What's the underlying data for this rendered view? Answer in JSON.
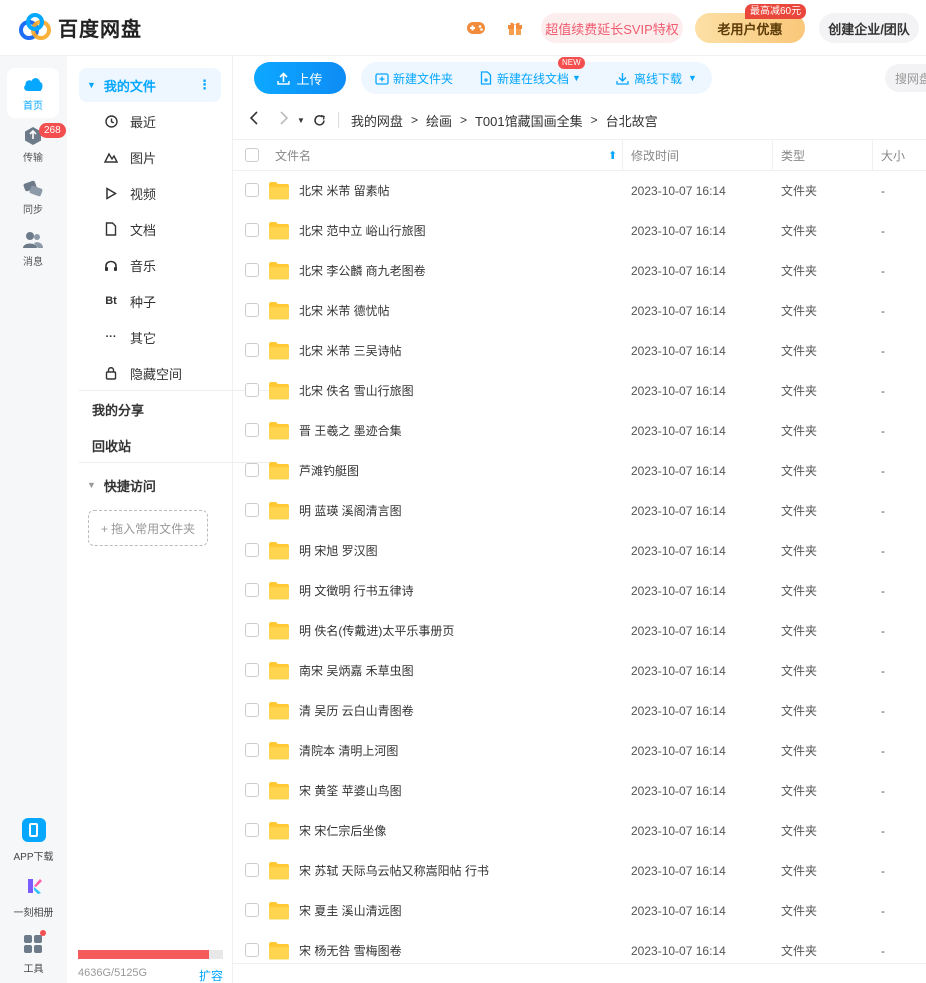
{
  "header": {
    "logo_text": "百度网盘",
    "svip_promo": "超值续费延长SVIP特权",
    "old_user_offer": "老用户优惠",
    "old_user_tag": "最高减60元",
    "enterprise": "创建企业/团队"
  },
  "rail": {
    "home": "首页",
    "transfer": "传输",
    "transfer_badge": "268",
    "sync": "同步",
    "messages": "消息",
    "app_download": "APP下载",
    "album": "一刻相册",
    "tools": "工具"
  },
  "sidebar": {
    "my_files": "我的文件",
    "more": "⋮",
    "items": [
      {
        "label": "最近",
        "icon": "clock-icon"
      },
      {
        "label": "图片",
        "icon": "image-icon"
      },
      {
        "label": "视频",
        "icon": "play-icon"
      },
      {
        "label": "文档",
        "icon": "document-icon"
      },
      {
        "label": "音乐",
        "icon": "headphones-icon"
      },
      {
        "label": "种子",
        "icon": "bt-icon",
        "glyph": "Bt"
      },
      {
        "label": "其它",
        "icon": "ellipsis-icon",
        "glyph": "···"
      },
      {
        "label": "隐藏空间",
        "icon": "lock-icon"
      }
    ],
    "my_share": "我的分享",
    "recycle": "回收站",
    "quick_access": "快捷访问",
    "drop_hint": "+ 拖入常用文件夹",
    "storage_text": "4636G/5125G",
    "storage_used_fraction": 0.905,
    "expand": "扩容"
  },
  "toolbar": {
    "upload": "上传",
    "new_folder": "新建文件夹",
    "new_online_doc": "新建在线文档",
    "new_tag": "NEW",
    "offline_download": "离线下载",
    "search_placeholder": "搜网盘"
  },
  "breadcrumb": {
    "root": "我的网盘",
    "path": [
      "绘画",
      "T001馆藏国画全集",
      "台北故宫"
    ]
  },
  "table": {
    "columns": {
      "name": "文件名",
      "modified": "修改时间",
      "type": "类型",
      "size": "大小"
    },
    "rows": [
      {
        "name": "北宋  米芾 留素帖",
        "time": "2023-10-07 16:14",
        "type": "文件夹",
        "size": "-"
      },
      {
        "name": "北宋 范中立 峪山行旅图",
        "time": "2023-10-07 16:14",
        "type": "文件夹",
        "size": "-"
      },
      {
        "name": "北宋 李公麟 商九老图卷",
        "time": "2023-10-07 16:14",
        "type": "文件夹",
        "size": "-"
      },
      {
        "name": "北宋 米芾 德忧帖",
        "time": "2023-10-07 16:14",
        "type": "文件夹",
        "size": "-"
      },
      {
        "name": "北宋 米芾 三吴诗帖",
        "time": "2023-10-07 16:14",
        "type": "文件夹",
        "size": "-"
      },
      {
        "name": "北宋 佚名 雪山行旅图",
        "time": "2023-10-07 16:14",
        "type": "文件夹",
        "size": "-"
      },
      {
        "name": "晋 王羲之 墨迹合集",
        "time": "2023-10-07 16:14",
        "type": "文件夹",
        "size": "-"
      },
      {
        "name": "芦滩钓艇图",
        "time": "2023-10-07 16:14",
        "type": "文件夹",
        "size": "-"
      },
      {
        "name": "明 蓝瑛 溪阁清言图",
        "time": "2023-10-07 16:14",
        "type": "文件夹",
        "size": "-"
      },
      {
        "name": "明 宋旭 罗汉图",
        "time": "2023-10-07 16:14",
        "type": "文件夹",
        "size": "-"
      },
      {
        "name": "明 文徵明 行书五律诗",
        "time": "2023-10-07 16:14",
        "type": "文件夹",
        "size": "-"
      },
      {
        "name": "明 佚名(传戴进)太平乐事册页",
        "time": "2023-10-07 16:14",
        "type": "文件夹",
        "size": "-"
      },
      {
        "name": "南宋 吴炳嘉 禾草虫图",
        "time": "2023-10-07 16:14",
        "type": "文件夹",
        "size": "-"
      },
      {
        "name": "清 吴历 云白山青图卷",
        "time": "2023-10-07 16:14",
        "type": "文件夹",
        "size": "-"
      },
      {
        "name": "清院本 清明上河图",
        "time": "2023-10-07 16:14",
        "type": "文件夹",
        "size": "-"
      },
      {
        "name": "宋 黄筌 苹婆山鸟图",
        "time": "2023-10-07 16:14",
        "type": "文件夹",
        "size": "-"
      },
      {
        "name": "宋 宋仁宗后坐像",
        "time": "2023-10-07 16:14",
        "type": "文件夹",
        "size": "-"
      },
      {
        "name": "宋 苏轼 天际乌云帖又称嵩阳帖 行书",
        "time": "2023-10-07 16:14",
        "type": "文件夹",
        "size": "-"
      },
      {
        "name": "宋 夏圭 溪山清远图",
        "time": "2023-10-07 16:14",
        "type": "文件夹",
        "size": "-"
      },
      {
        "name": "宋 杨无咎 雪梅图卷",
        "time": "2023-10-07 16:14",
        "type": "文件夹",
        "size": "-"
      }
    ]
  },
  "colors": {
    "accent": "#06a7ff",
    "folder": "#ffc933",
    "badge": "#f54e4e"
  }
}
